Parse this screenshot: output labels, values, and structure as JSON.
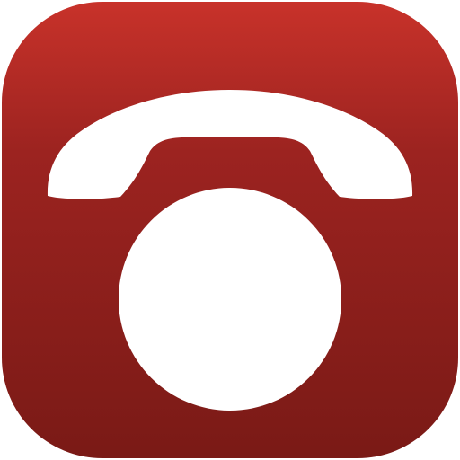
{
  "app_icon": {
    "name": "telephone-app-icon",
    "glyph": "rotary-telephone-icon",
    "colors": {
      "gradient_top": "#c8322a",
      "gradient_mid": "#9c2320",
      "gradient_bottom": "#7a1a16",
      "glyph": "#ffffff"
    }
  }
}
